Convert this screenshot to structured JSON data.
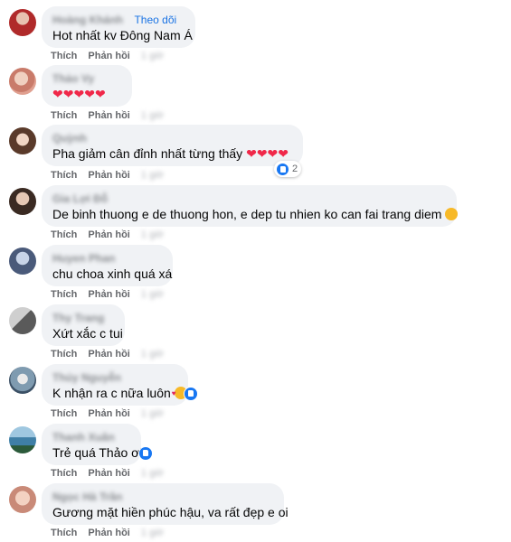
{
  "follow_label": "Theo dõi",
  "action_like": "Thích",
  "action_reply": "Phản hồi",
  "comments": [
    {
      "author": "Hoàng Khánh",
      "text": "Hot nhất kv Đông Nam Á",
      "time": "1 giờ"
    },
    {
      "author": "Thảo Vy",
      "text": "",
      "time": "1 giờ"
    },
    {
      "author": "Quỳnh",
      "text": "Pha giảm cân đỉnh nhất từng thấy",
      "time": "1 giờ",
      "reaction_count": "2"
    },
    {
      "author": "Gia Lợi Đỗ",
      "text": "De binh thuong e de thuong hon, e dep tu nhien ko can fai trang diem",
      "time": "1 giờ"
    },
    {
      "author": "Huyen Phan",
      "text": "chu choa xinh quá xá",
      "time": "1 giờ"
    },
    {
      "author": "Thy Trang",
      "text": "Xứt xắc c tui",
      "time": "1 giờ"
    },
    {
      "author": "Thúy Nguyễn",
      "text": "K nhận ra c nữa luôn",
      "time": "1 giờ"
    },
    {
      "author": "Thanh Xuân",
      "text": "Trẻ quá Thảo ơi",
      "time": "1 giờ"
    },
    {
      "author": "Ngọc Hà Trần",
      "text": "Gương mặt hiền phúc hậu, va rất đẹp e oi",
      "time": "1 giờ"
    }
  ],
  "icons": {
    "heart": "red-heart-emoji",
    "like": "like-reaction-icon",
    "smile": "smiling-face-emoji",
    "love": "smiling-face-with-hearts-emoji"
  },
  "colors": {
    "bubble": "#f0f2f5",
    "link": "#1b74e4",
    "muted": "#65676b",
    "like": "#1877f2",
    "heart": "#f02849"
  }
}
